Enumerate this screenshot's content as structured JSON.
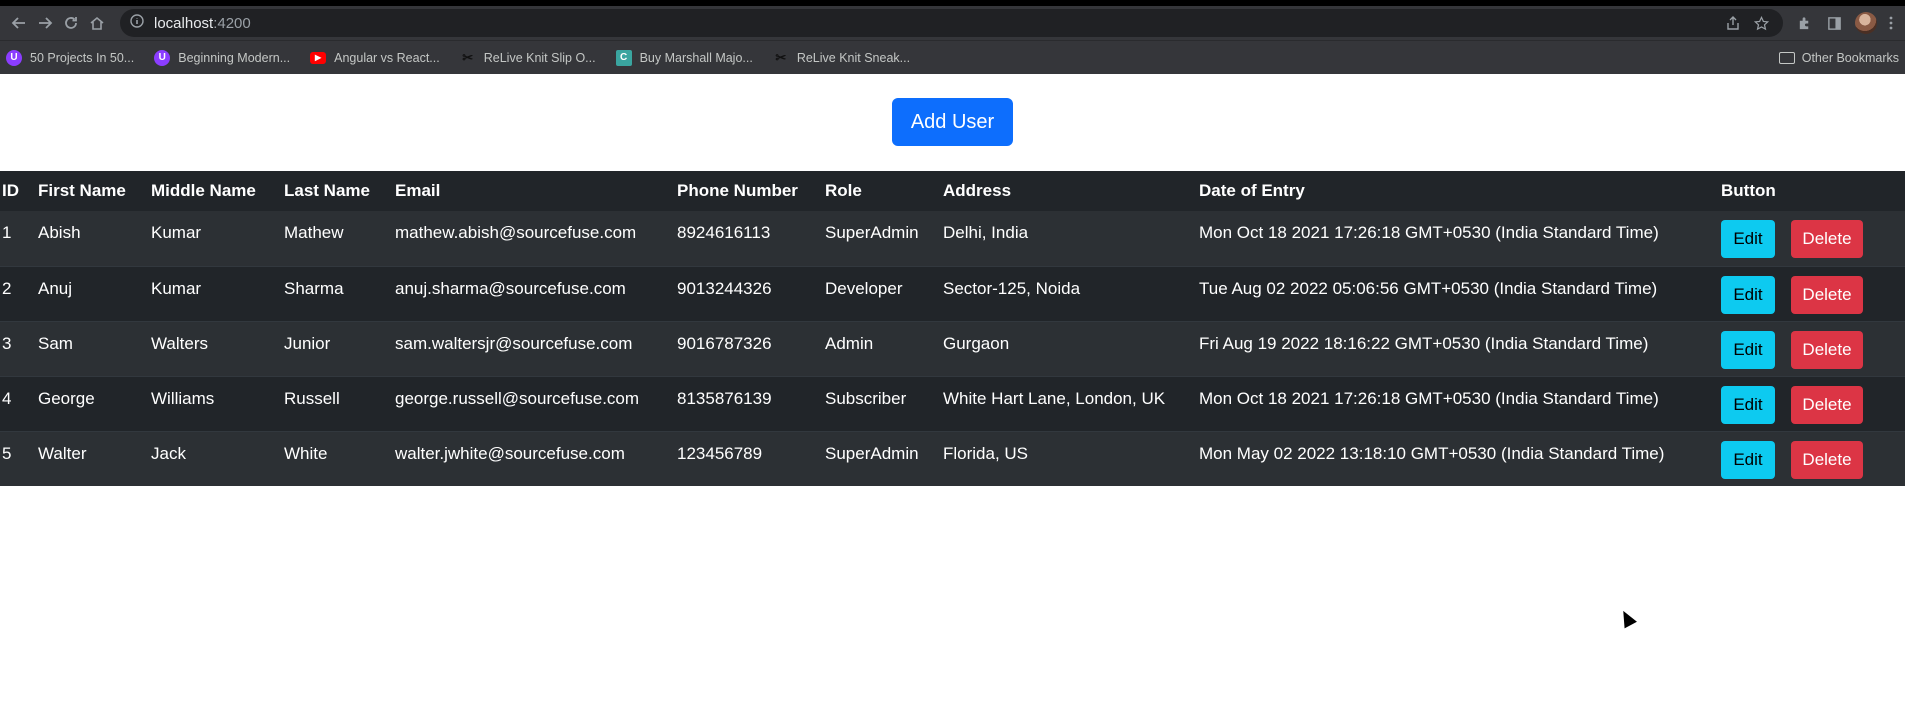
{
  "browser": {
    "url_host": "localhost",
    "url_port": ":4200",
    "bookmarks": [
      {
        "label": "50 Projects In 50...",
        "color": "#8b3dff"
      },
      {
        "label": "Beginning Modern...",
        "color": "#8b3dff"
      },
      {
        "label": "Angular vs React...",
        "color": "#ff0000"
      },
      {
        "label": "ReLive Knit Slip O...",
        "color": "#222222"
      },
      {
        "label": "Buy Marshall Majo...",
        "color": "#3aa5a0"
      },
      {
        "label": "ReLive Knit Sneak...",
        "color": "#222222"
      }
    ],
    "other_bookmarks": "Other Bookmarks"
  },
  "page": {
    "add_button": "Add User"
  },
  "table": {
    "headers": [
      "ID",
      "First Name",
      "Middle Name",
      "Last Name",
      "Email",
      "Phone Number",
      "Role",
      "Address",
      "Date of Entry",
      "Button"
    ],
    "rows": [
      {
        "id": "1",
        "first": "Abish",
        "middle": "Kumar",
        "last": "Mathew",
        "email": "mathew.abish@sourcefuse.com",
        "phone": "8924616113",
        "role": "SuperAdmin",
        "address": "Delhi, India",
        "date": "Mon Oct 18 2021 17:26:18 GMT+0530 (India Standard Time)",
        "edit": "Edit",
        "delete": "Delete"
      },
      {
        "id": "2",
        "first": "Anuj",
        "middle": "Kumar",
        "last": "Sharma",
        "email": "anuj.sharma@sourcefuse.com",
        "phone": "9013244326",
        "role": "Developer",
        "address": "Sector-125, Noida",
        "date": "Tue Aug 02 2022 05:06:56 GMT+0530 (India Standard Time)",
        "edit": "Edit",
        "delete": "Delete"
      },
      {
        "id": "3",
        "first": "Sam",
        "middle": "Walters",
        "last": "Junior",
        "email": "sam.waltersjr@sourcefuse.com",
        "phone": "9016787326",
        "role": "Admin",
        "address": "Gurgaon",
        "date": "Fri Aug 19 2022 18:16:22 GMT+0530 (India Standard Time)",
        "edit": "Edit",
        "delete": "Delete"
      },
      {
        "id": "4",
        "first": "George",
        "middle": "Williams",
        "last": "Russell",
        "email": "george.russell@sourcefuse.com",
        "phone": "8135876139",
        "role": "Subscriber",
        "address": "White Hart Lane, London, UK",
        "date": "Mon Oct 18 2021 17:26:18 GMT+0530 (India Standard Time)",
        "edit": "Edit",
        "delete": "Delete"
      },
      {
        "id": "5",
        "first": "Walter",
        "middle": "Jack",
        "last": "White",
        "email": "walter.jwhite@sourcefuse.com",
        "phone": "123456789",
        "role": "SuperAdmin",
        "address": "Florida, US",
        "date": "Mon May 02 2022 13:18:10 GMT+0530 (India Standard Time)",
        "edit": "Edit",
        "delete": "Delete"
      }
    ]
  },
  "colors": {
    "primary": "#0d6efd",
    "info": "#0dcaf0",
    "danger": "#dc3545",
    "table_dark": "#212529"
  }
}
